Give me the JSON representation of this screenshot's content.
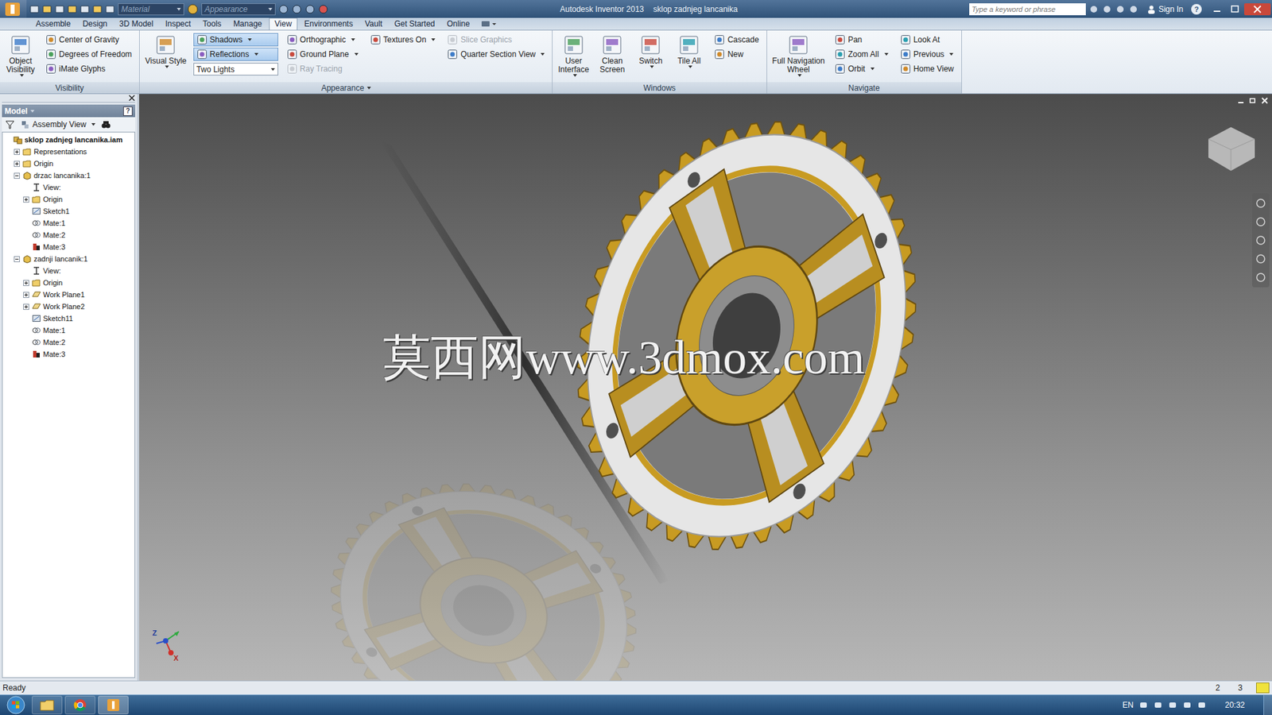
{
  "titlebar": {
    "material": "Material",
    "appearance": "Appearance",
    "app": "Autodesk Inventor 2013",
    "document": "sklop zadnjeg lancanika",
    "search_placeholder": "Type a keyword or phrase",
    "sign_in": "Sign In",
    "help": "?"
  },
  "menu_tabs": [
    {
      "label": "Assemble",
      "selected": false
    },
    {
      "label": "Design",
      "selected": false
    },
    {
      "label": "3D Model",
      "selected": false
    },
    {
      "label": "Inspect",
      "selected": false
    },
    {
      "label": "Tools",
      "selected": false
    },
    {
      "label": "Manage",
      "selected": false
    },
    {
      "label": "View",
      "selected": true
    },
    {
      "label": "Environments",
      "selected": false
    },
    {
      "label": "Vault",
      "selected": false
    },
    {
      "label": "Get Started",
      "selected": false
    },
    {
      "label": "Online",
      "selected": false
    }
  ],
  "ribbon": {
    "panels": [
      {
        "title": "Visibility",
        "menu": false,
        "items": [
          {
            "kind": "large",
            "label": "Object\nVisibility",
            "menu": true
          },
          {
            "kind": "column",
            "buttons": [
              {
                "kind": "small",
                "label": "Center of Gravity",
                "menu": false,
                "selected": false,
                "disabled": false
              },
              {
                "kind": "small",
                "label": "Degrees of Freedom",
                "menu": false,
                "selected": false,
                "disabled": false
              },
              {
                "kind": "small",
                "label": "iMate Glyphs",
                "menu": false,
                "selected": false,
                "disabled": false
              }
            ]
          }
        ]
      },
      {
        "title": "Appearance",
        "menu": true,
        "items": [
          {
            "kind": "large",
            "label": "Visual Style",
            "menu": true
          },
          {
            "kind": "column",
            "buttons": [
              {
                "kind": "small",
                "label": "Shadows",
                "menu": true,
                "selected": true,
                "disabled": false
              },
              {
                "kind": "small",
                "label": "Reflections",
                "menu": true,
                "selected": true,
                "disabled": false
              },
              {
                "kind": "combo",
                "label": "Two Lights",
                "menu": true,
                "selected": false,
                "disabled": false
              }
            ]
          },
          {
            "kind": "column",
            "buttons": [
              {
                "kind": "small",
                "label": "Orthographic",
                "menu": true,
                "selected": false,
                "disabled": false
              },
              {
                "kind": "small",
                "label": "Ground Plane",
                "menu": true,
                "selected": false,
                "disabled": false
              },
              {
                "kind": "small",
                "label": "Ray Tracing",
                "menu": false,
                "selected": false,
                "disabled": true
              }
            ]
          },
          {
            "kind": "column",
            "buttons": [
              {
                "kind": "small",
                "label": "Textures On",
                "menu": true,
                "selected": false,
                "disabled": false
              }
            ]
          },
          {
            "kind": "column",
            "buttons": [
              {
                "kind": "small",
                "label": "Slice Graphics",
                "menu": false,
                "selected": false,
                "disabled": true
              },
              {
                "kind": "small",
                "label": "Quarter Section View",
                "menu": true,
                "selected": false,
                "disabled": false
              }
            ]
          }
        ]
      },
      {
        "title": "Windows",
        "menu": false,
        "items": [
          {
            "kind": "large",
            "label": "User\nInterface",
            "menu": true
          },
          {
            "kind": "large",
            "label": "Clean\nScreen",
            "menu": false
          },
          {
            "kind": "large",
            "label": "Switch",
            "menu": true
          },
          {
            "kind": "large",
            "label": "Tile All",
            "menu": true
          },
          {
            "kind": "column",
            "buttons": [
              {
                "kind": "small",
                "label": "Cascade",
                "menu": false,
                "selected": false,
                "disabled": false
              },
              {
                "kind": "small",
                "label": "New",
                "menu": false,
                "selected": false,
                "disabled": false
              }
            ]
          }
        ]
      },
      {
        "title": "Navigate",
        "menu": false,
        "items": [
          {
            "kind": "large",
            "label": "Full Navigation\nWheel",
            "menu": true
          },
          {
            "kind": "column",
            "buttons": [
              {
                "kind": "small",
                "label": "Pan",
                "menu": false,
                "selected": false,
                "disabled": false
              },
              {
                "kind": "small",
                "label": "Zoom All",
                "menu": true,
                "selected": false,
                "disabled": false
              },
              {
                "kind": "small",
                "label": "Orbit",
                "menu": true,
                "selected": false,
                "disabled": false
              }
            ]
          },
          {
            "kind": "column",
            "buttons": [
              {
                "kind": "small",
                "label": "Look At",
                "menu": false,
                "selected": false,
                "disabled": false
              },
              {
                "kind": "small",
                "label": "Previous",
                "menu": true,
                "selected": false,
                "disabled": false
              },
              {
                "kind": "small",
                "label": "Home View",
                "menu": false,
                "selected": false,
                "disabled": false
              }
            ]
          }
        ]
      }
    ]
  },
  "browser": {
    "title": "Model",
    "help": "?",
    "view_mode": "Assembly View",
    "tree": [
      {
        "label": "sklop zadnjeg lancanika.iam",
        "level": 0,
        "kind": "assembly",
        "has_toggle": false,
        "expanded": true,
        "bold": true
      },
      {
        "label": "Representations",
        "level": 1,
        "kind": "folder",
        "has_toggle": true,
        "expanded": false,
        "bold": false
      },
      {
        "label": "Origin",
        "level": 1,
        "kind": "folder",
        "has_toggle": true,
        "expanded": false,
        "bold": false
      },
      {
        "label": "drzac lancanika:1",
        "level": 1,
        "kind": "part",
        "has_toggle": true,
        "expanded": true,
        "bold": false
      },
      {
        "label": "View:",
        "level": 2,
        "kind": "view",
        "has_toggle": false,
        "expanded": false,
        "bold": false
      },
      {
        "label": "Origin",
        "level": 2,
        "kind": "folder",
        "has_toggle": true,
        "expanded": false,
        "bold": false
      },
      {
        "label": "Sketch1",
        "level": 2,
        "kind": "sketch",
        "has_toggle": false,
        "expanded": false,
        "bold": false
      },
      {
        "label": "Mate:1",
        "level": 2,
        "kind": "mate",
        "has_toggle": false,
        "expanded": false,
        "bold": false
      },
      {
        "label": "Mate:2",
        "level": 2,
        "kind": "mate",
        "has_toggle": false,
        "expanded": false,
        "bold": false
      },
      {
        "label": "Mate:3",
        "level": 2,
        "kind": "flush",
        "has_toggle": false,
        "expanded": false,
        "bold": false
      },
      {
        "label": "zadnji lancanik:1",
        "level": 1,
        "kind": "part",
        "has_toggle": true,
        "expanded": true,
        "bold": false
      },
      {
        "label": "View:",
        "level": 2,
        "kind": "view",
        "has_toggle": false,
        "expanded": false,
        "bold": false
      },
      {
        "label": "Origin",
        "level": 2,
        "kind": "folder",
        "has_toggle": true,
        "expanded": false,
        "bold": false
      },
      {
        "label": "Work Plane1",
        "level": 2,
        "kind": "plane",
        "has_toggle": true,
        "expanded": false,
        "bold": false
      },
      {
        "label": "Work Plane2",
        "level": 2,
        "kind": "plane",
        "has_toggle": true,
        "expanded": false,
        "bold": false
      },
      {
        "label": "Sketch11",
        "level": 2,
        "kind": "sketch",
        "has_toggle": false,
        "expanded": false,
        "bold": false
      },
      {
        "label": "Mate:1",
        "level": 2,
        "kind": "mate",
        "has_toggle": false,
        "expanded": false,
        "bold": false
      },
      {
        "label": "Mate:2",
        "level": 2,
        "kind": "mate",
        "has_toggle": false,
        "expanded": false,
        "bold": false
      },
      {
        "label": "Mate:3",
        "level": 2,
        "kind": "flush",
        "has_toggle": false,
        "expanded": false,
        "bold": false
      }
    ]
  },
  "viewport": {
    "watermark": "莫西网www.3dmox.com",
    "axes": [
      "Z",
      "X"
    ]
  },
  "status_bar": {
    "text": "Ready",
    "counters": [
      "2",
      "3"
    ]
  },
  "taskbar": {
    "language": "EN",
    "time": "20:32"
  }
}
